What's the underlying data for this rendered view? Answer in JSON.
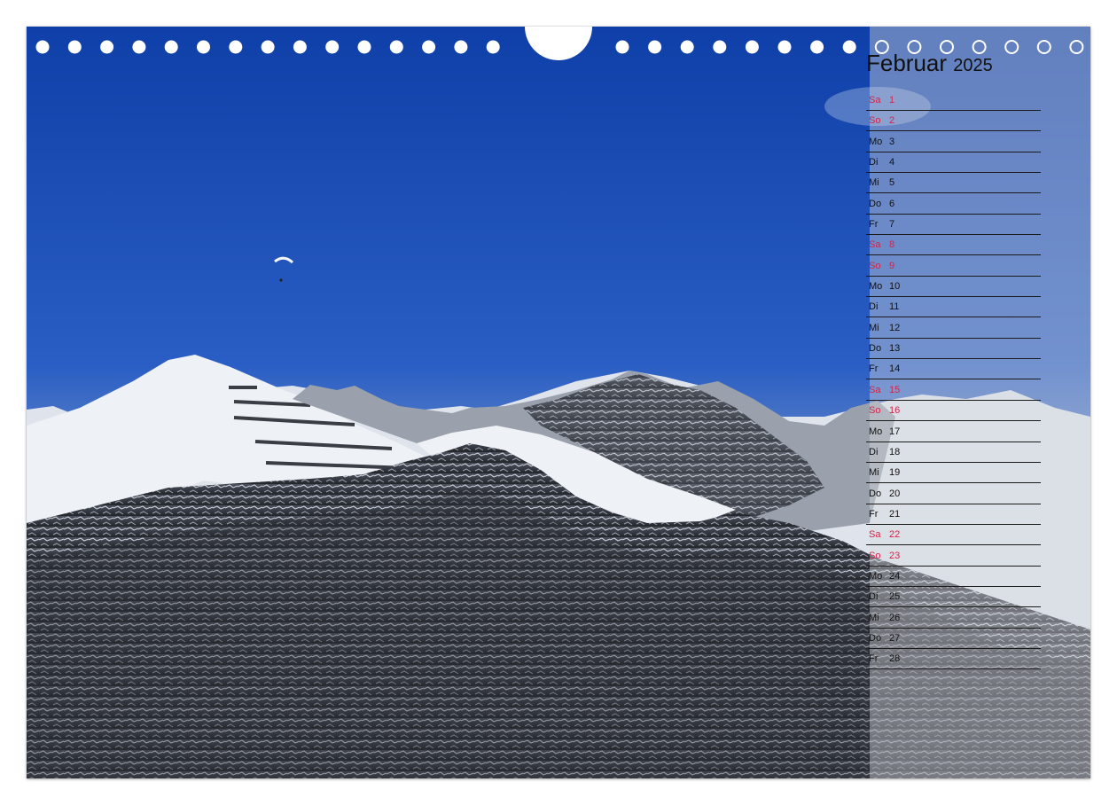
{
  "calendar": {
    "month": "Februar",
    "year": "2025",
    "weekend_color": "#d4244b",
    "days": [
      {
        "dn": "Sa",
        "d": "1",
        "we": true
      },
      {
        "dn": "So",
        "d": "2",
        "we": true
      },
      {
        "dn": "Mo",
        "d": "3",
        "we": false
      },
      {
        "dn": "Di",
        "d": "4",
        "we": false
      },
      {
        "dn": "Mi",
        "d": "5",
        "we": false
      },
      {
        "dn": "Do",
        "d": "6",
        "we": false
      },
      {
        "dn": "Fr",
        "d": "7",
        "we": false
      },
      {
        "dn": "Sa",
        "d": "8",
        "we": true
      },
      {
        "dn": "So",
        "d": "9",
        "we": true
      },
      {
        "dn": "Mo",
        "d": "10",
        "we": false
      },
      {
        "dn": "Di",
        "d": "11",
        "we": false
      },
      {
        "dn": "Mi",
        "d": "12",
        "we": false
      },
      {
        "dn": "Do",
        "d": "13",
        "we": false
      },
      {
        "dn": "Fr",
        "d": "14",
        "we": false
      },
      {
        "dn": "Sa",
        "d": "15",
        "we": true
      },
      {
        "dn": "So",
        "d": "16",
        "we": true
      },
      {
        "dn": "Mo",
        "d": "17",
        "we": false
      },
      {
        "dn": "Di",
        "d": "18",
        "we": false
      },
      {
        "dn": "Mi",
        "d": "19",
        "we": false
      },
      {
        "dn": "Do",
        "d": "20",
        "we": false
      },
      {
        "dn": "Fr",
        "d": "21",
        "we": false
      },
      {
        "dn": "Sa",
        "d": "22",
        "we": true
      },
      {
        "dn": "So",
        "d": "23",
        "we": true
      },
      {
        "dn": "Mo",
        "d": "24",
        "we": false
      },
      {
        "dn": "Di",
        "d": "25",
        "we": false
      },
      {
        "dn": "Mi",
        "d": "26",
        "we": false
      },
      {
        "dn": "Do",
        "d": "27",
        "we": false
      },
      {
        "dn": "Fr",
        "d": "28",
        "we": false
      }
    ]
  },
  "photo": {
    "subject": "snow-covered-alpine-peaks-with-paraglider",
    "sky_color": "#2a5ec4",
    "snow_color": "#e8ecf2",
    "rock_color": "#2d3038"
  },
  "binding": {
    "hole_color": "#ffffff"
  }
}
